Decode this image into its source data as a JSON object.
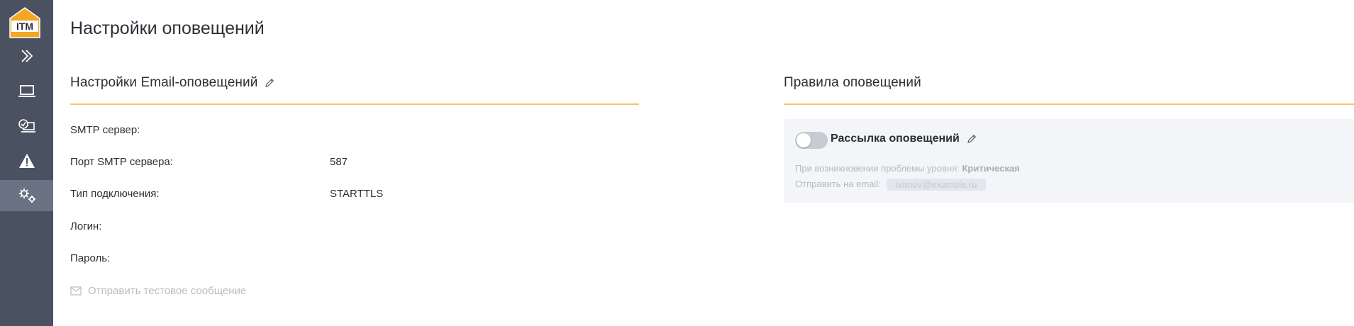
{
  "sidebar": {
    "logo_text": "ITM",
    "items": [
      {
        "name": "expand",
        "icon": "chevrons-right-icon"
      },
      {
        "name": "devices",
        "icon": "laptop-icon"
      },
      {
        "name": "monitoring",
        "icon": "laptop-check-icon"
      },
      {
        "name": "alerts",
        "icon": "warning-icon"
      },
      {
        "name": "settings",
        "icon": "gears-icon",
        "active": true
      }
    ]
  },
  "page": {
    "title": "Настройки оповещений"
  },
  "email_settings": {
    "title": "Настройки Email-оповещений",
    "fields": [
      {
        "label": "SMTP сервер:",
        "value": ""
      },
      {
        "label": "Порт SMTP сервера:",
        "value": "587"
      },
      {
        "label": "Тип подключения:",
        "value": "STARTTLS"
      },
      {
        "label": "Логин:",
        "value": ""
      },
      {
        "label": "Пароль:",
        "value": ""
      }
    ],
    "test_message_label": "Отправить тестовое сообщение"
  },
  "notification_rules": {
    "title": "Правила оповещений",
    "rule": {
      "name": "Рассылка оповещений",
      "enabled": false,
      "level_prefix": "При возникновении проблемы уровня:",
      "level_value": "Критическая",
      "email_prefix": "Отправить на email:",
      "email_value": "ivanov@example.ru"
    }
  },
  "colors": {
    "sidebar_bg": "#4a5262",
    "sidebar_active": "#6a7283",
    "accent_rule": "#f2c46a",
    "logo_orange": "#f5a623"
  }
}
